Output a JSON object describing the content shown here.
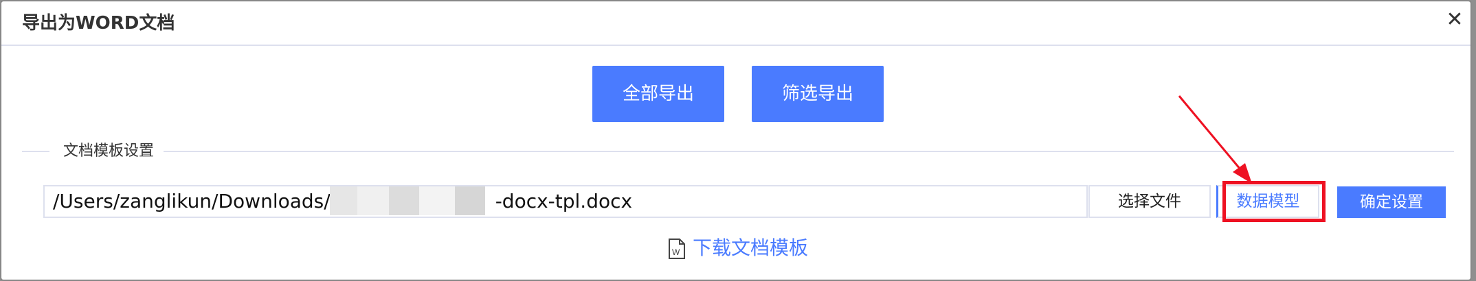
{
  "dialog": {
    "title": "导出为WORD文档",
    "close_icon": "close-icon"
  },
  "actions": {
    "export_all_label": "全部导出",
    "filter_export_label": "筛选导出"
  },
  "template_section": {
    "legend": "文档模板设置",
    "path_prefix": "/Users/zanglikun/Downloads/",
    "path_suffix": "-docx-tpl.docx",
    "choose_file_label": "选择文件",
    "data_model_label": "数据模型",
    "confirm_label": "确定设置",
    "download_label": "下载文档模板",
    "download_icon": "word-document-icon"
  },
  "colors": {
    "primary": "#4a7bff",
    "annotation_red": "#ee1122",
    "overlay": "#8f8f8f"
  }
}
